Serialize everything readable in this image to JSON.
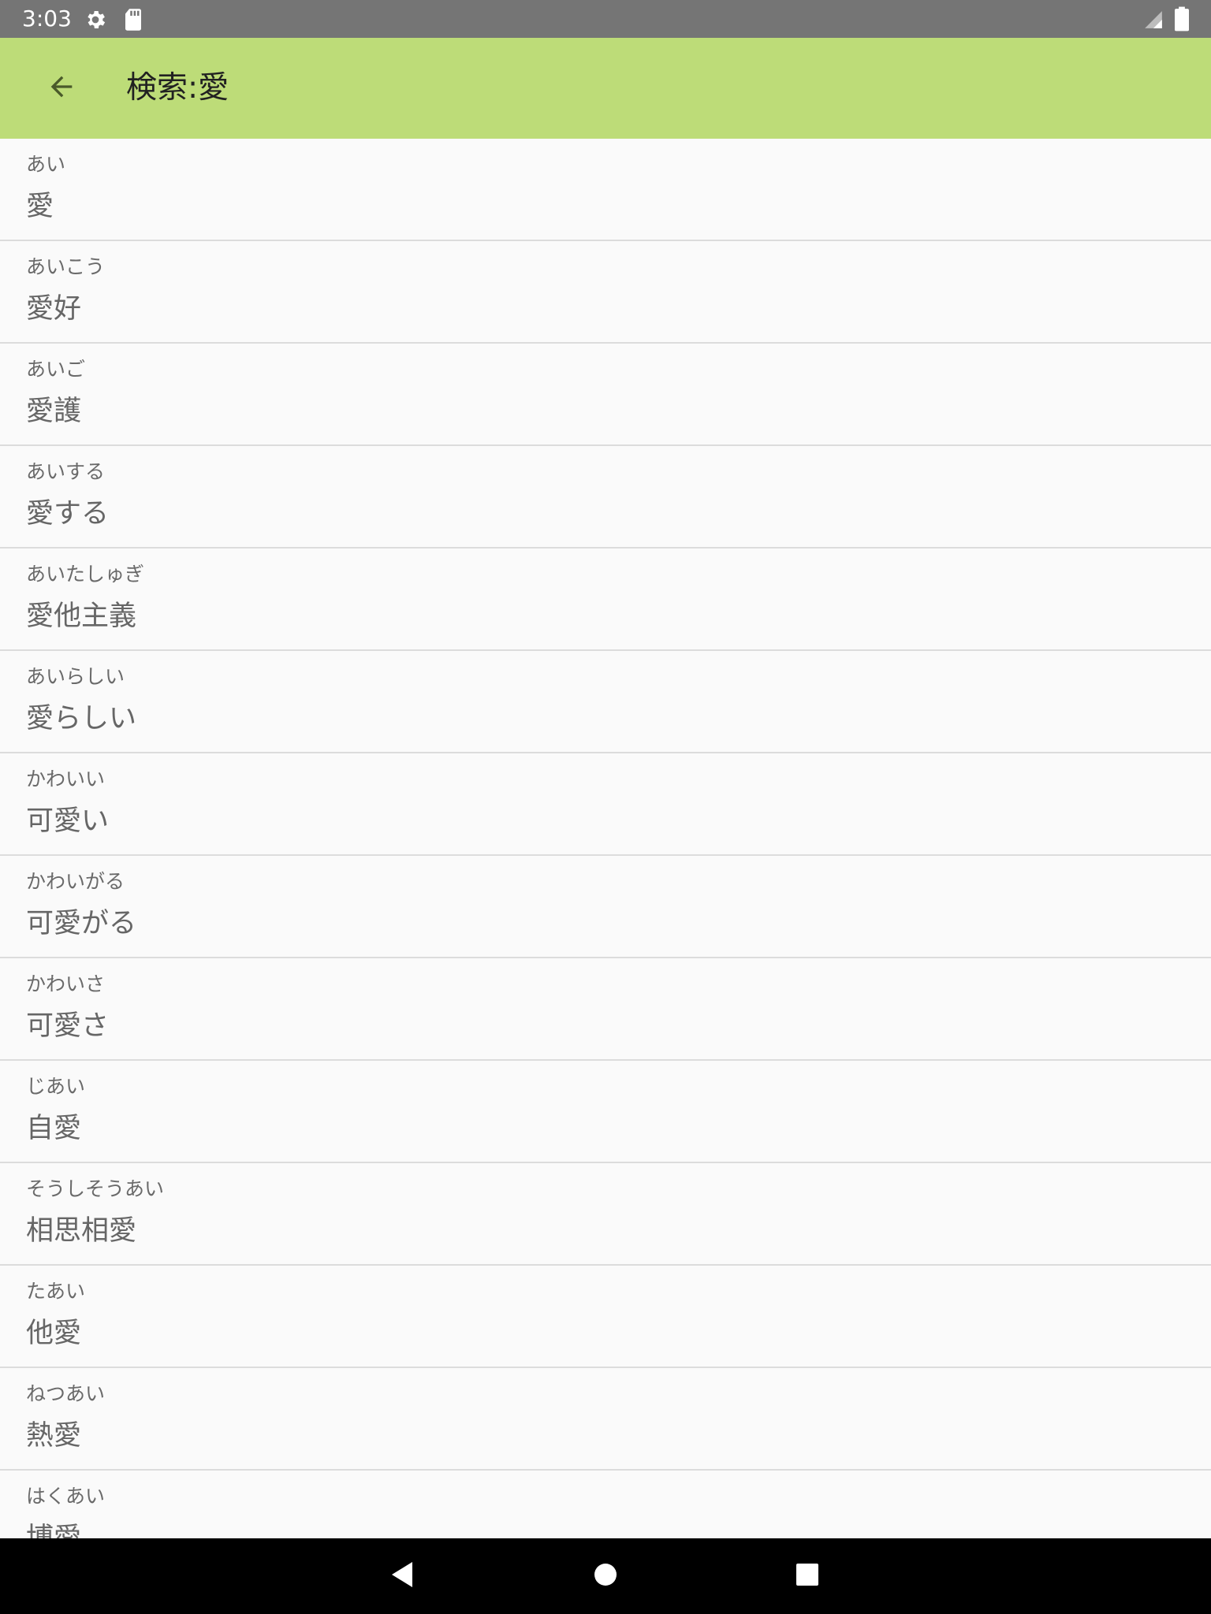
{
  "status_bar": {
    "time": "3:03",
    "icons": [
      "gear-icon",
      "sd-card-icon",
      "signal-icon",
      "battery-icon"
    ]
  },
  "toolbar": {
    "title": "検索:愛",
    "back_icon": "arrow-back-icon",
    "background": "#bddc78"
  },
  "results": [
    {
      "reading": "あい",
      "word": "愛"
    },
    {
      "reading": "あいこう",
      "word": "愛好"
    },
    {
      "reading": "あいご",
      "word": "愛護"
    },
    {
      "reading": "あいする",
      "word": "愛する"
    },
    {
      "reading": "あいたしゅぎ",
      "word": "愛他主義"
    },
    {
      "reading": "あいらしい",
      "word": "愛らしい"
    },
    {
      "reading": "かわいい",
      "word": "可愛い"
    },
    {
      "reading": "かわいがる",
      "word": "可愛がる"
    },
    {
      "reading": "かわいさ",
      "word": "可愛さ"
    },
    {
      "reading": "じあい",
      "word": "自愛"
    },
    {
      "reading": "そうしそうあい",
      "word": "相思相愛"
    },
    {
      "reading": "たあい",
      "word": "他愛"
    },
    {
      "reading": "ねつあい",
      "word": "熱愛"
    },
    {
      "reading": "はくあい",
      "word": "博愛"
    }
  ],
  "nav_bar": {
    "icons": [
      "back-triangle-icon",
      "home-circle-icon",
      "recents-square-icon"
    ]
  }
}
